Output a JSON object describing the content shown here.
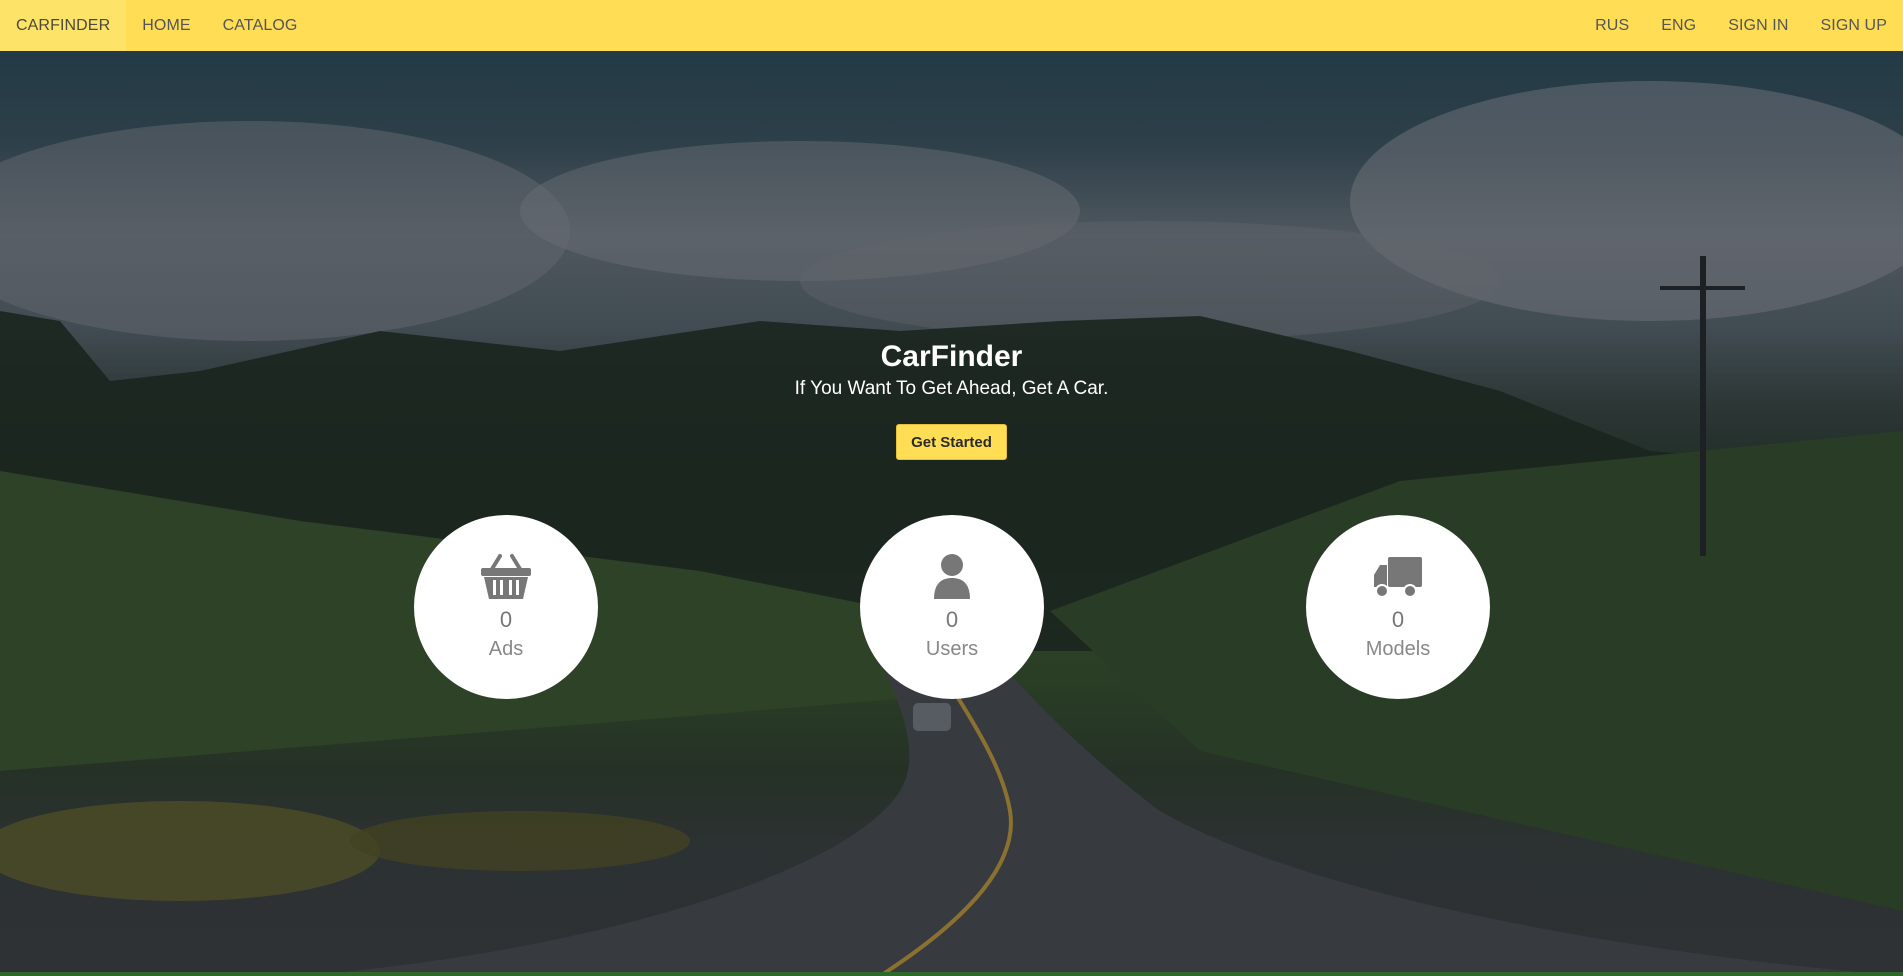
{
  "nav": {
    "brand": "CARFINDER",
    "left_items": [
      {
        "label": "HOME"
      },
      {
        "label": "CATALOG"
      }
    ],
    "right_items": [
      {
        "label": "RUS"
      },
      {
        "label": "ENG"
      },
      {
        "label": "SIGN IN"
      },
      {
        "label": "SIGN UP"
      }
    ]
  },
  "hero": {
    "title": "CarFinder",
    "subtitle": "If You Want To Get Ahead, Get A Car.",
    "cta_label": "Get Started"
  },
  "stats": [
    {
      "icon": "basket-icon",
      "value": "0",
      "label": "Ads"
    },
    {
      "icon": "user-icon",
      "value": "0",
      "label": "Users"
    },
    {
      "icon": "truck-icon",
      "value": "0",
      "label": "Models"
    }
  ],
  "colors": {
    "accent": "#ffde55",
    "icon": "#777777"
  }
}
